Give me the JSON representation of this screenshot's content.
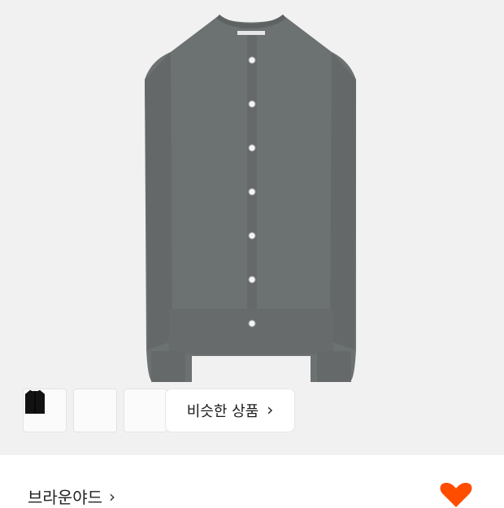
{
  "product_image": {
    "garment_label_text": ""
  },
  "color_thumbnails": [
    {
      "name": "navy",
      "color": "#2b3a55"
    },
    {
      "name": "black",
      "color": "#1c1c1c"
    },
    {
      "name": "black-dark",
      "color": "#121212"
    }
  ],
  "similar_products": {
    "label": "비슷한 상품",
    "chevron": "›"
  },
  "brand": {
    "name": "브라운야드",
    "chevron": "›"
  },
  "wishlist": {
    "icon": "heart-icon",
    "color": "#ff4d00"
  },
  "colors": {
    "garment": "#6c7172",
    "background": "#f1f1f1"
  }
}
